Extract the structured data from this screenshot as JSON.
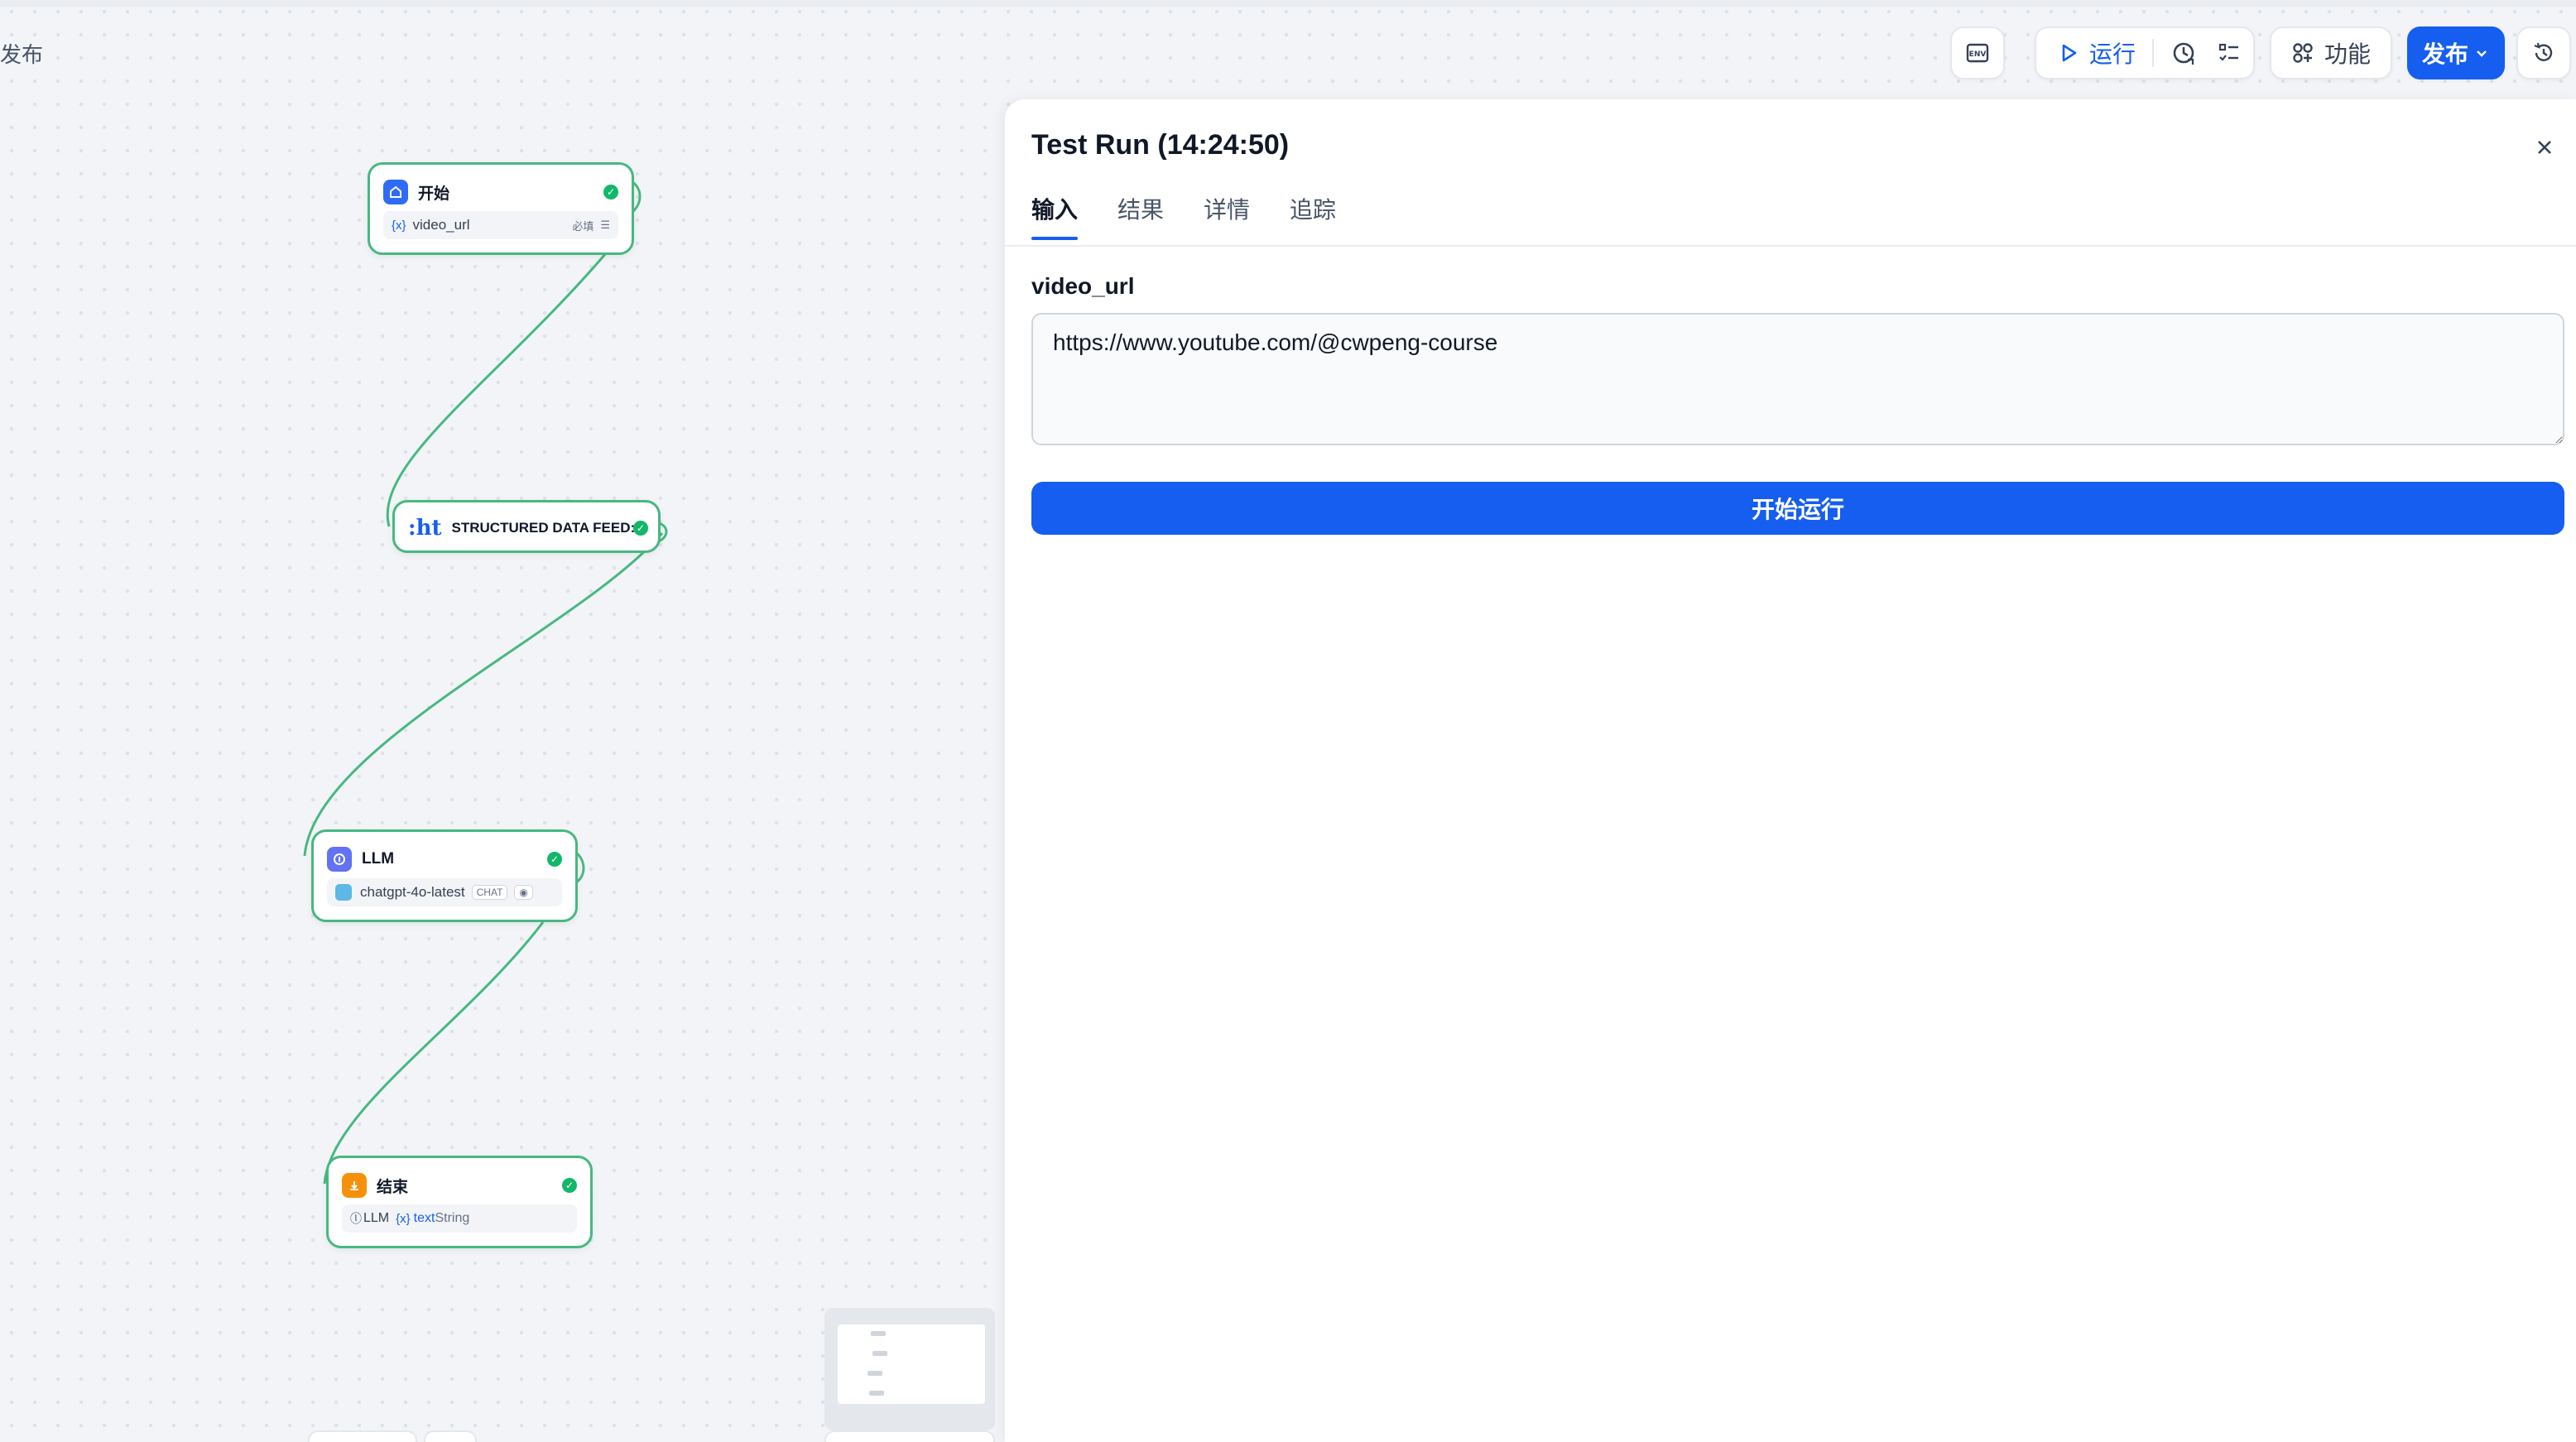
{
  "app": {
    "label": "发布"
  },
  "toolbar": {
    "env_icon": "env-icon",
    "run_label": "运行",
    "features_label": "功能",
    "publish_label": "发布"
  },
  "nodes": {
    "start": {
      "title": "开始",
      "var_mark": "{x}",
      "var_name": "video_url",
      "required": "必填"
    },
    "feed": {
      "icon_text": ":ht",
      "title": "STRUCTURED DATA FEED:"
    },
    "llm": {
      "title": "LLM",
      "model": "chatgpt-4o-latest",
      "mode": "CHAT"
    },
    "end": {
      "title": "结束",
      "source": "LLM",
      "var_mark": "{x}",
      "var_name": "text",
      "var_type": "String"
    }
  },
  "panel": {
    "title": "Test Run (14:24:50)",
    "tabs": [
      {
        "label": "输入"
      },
      {
        "label": "结果"
      },
      {
        "label": "详情"
      },
      {
        "label": "追踪"
      }
    ],
    "field_label": "video_url",
    "field_value": "https://www.youtube.com/@cwpeng-course",
    "run_button": "开始运行"
  },
  "colors": {
    "accent": "#155eef",
    "success": "#12b76a",
    "edge": "#47b881",
    "start_icon": "#2e6bf6",
    "llm_icon": "#6172f3",
    "end_icon": "#f79009"
  }
}
